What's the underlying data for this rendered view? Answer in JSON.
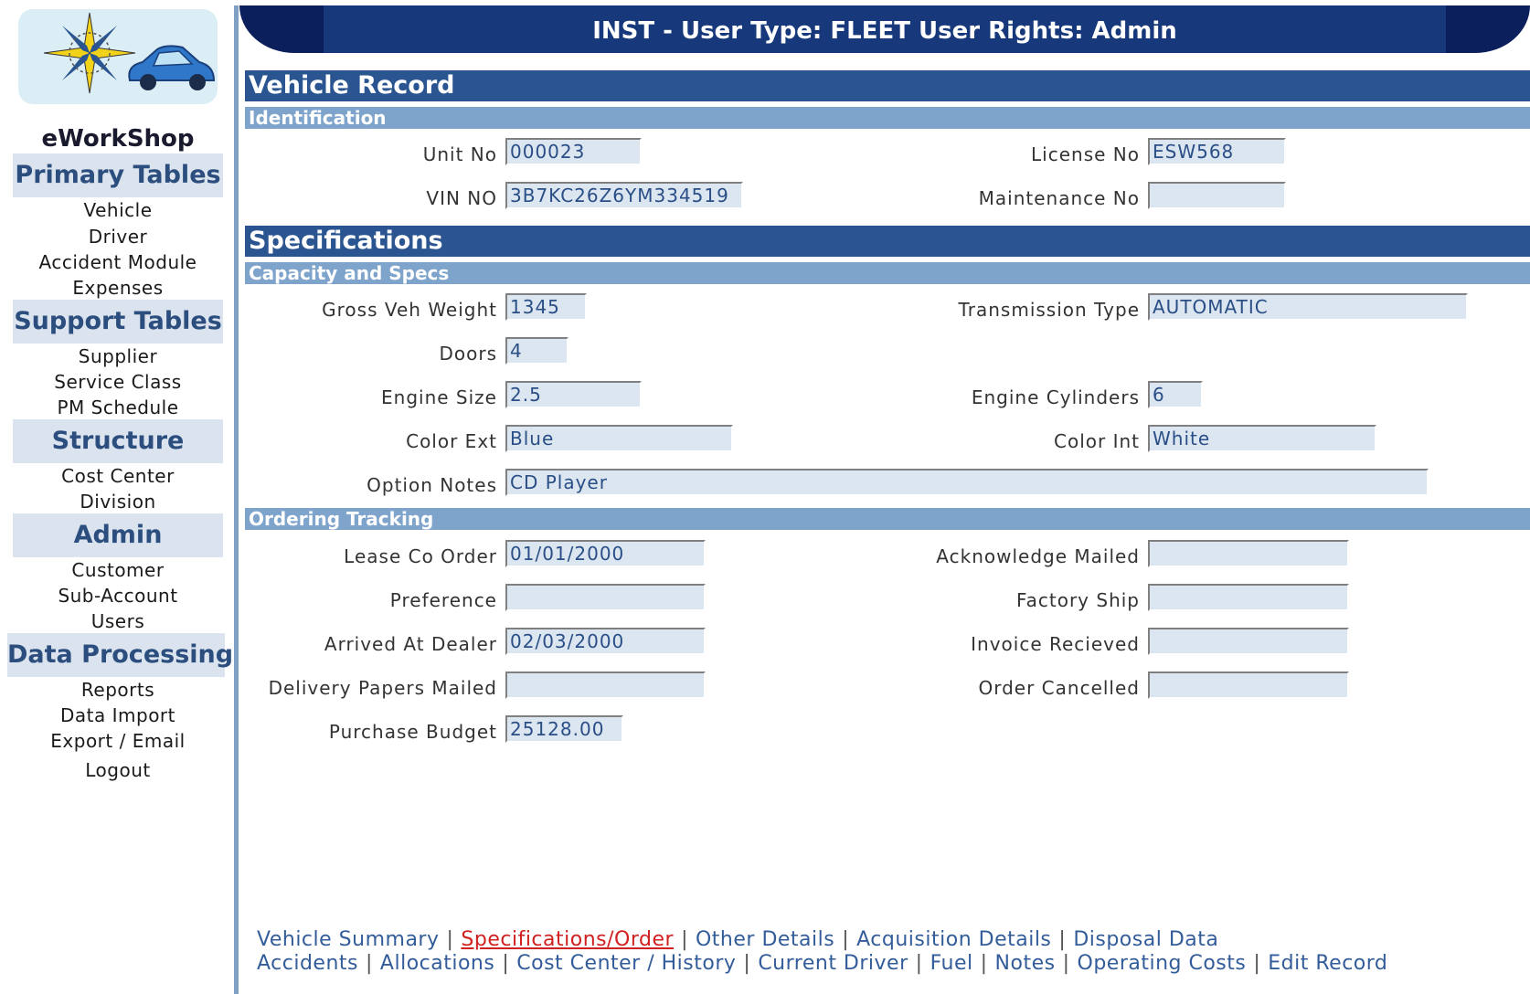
{
  "header": {
    "title": "INST - User Type: FLEET User Rights: Admin"
  },
  "sidebar": {
    "app_name": "eWorkShop",
    "sections": [
      {
        "title": "Primary Tables",
        "items": [
          "Vehicle",
          "Driver",
          "Accident Module",
          "Expenses"
        ]
      },
      {
        "title": "Support Tables",
        "items": [
          "Supplier",
          "Service Class",
          "PM Schedule"
        ]
      },
      {
        "title": "Structure",
        "items": [
          "Cost Center",
          "Division"
        ]
      },
      {
        "title": "Admin",
        "items": [
          "Customer",
          "Sub-Account",
          "Users"
        ]
      },
      {
        "title": "Data Processing",
        "items": [
          "Reports",
          "Data Import",
          "Export / Email",
          "Logout"
        ]
      }
    ]
  },
  "main": {
    "record_title": "Vehicle Record",
    "identification": {
      "title": "Identification",
      "unit_no": {
        "label": "Unit No",
        "value": "000023"
      },
      "license_no": {
        "label": "License No",
        "value": "ESW568"
      },
      "vin_no": {
        "label": "VIN NO",
        "value": "3B7KC26Z6YM334519"
      },
      "maintenance_no": {
        "label": "Maintenance No",
        "value": ""
      }
    },
    "specifications_title": "Specifications",
    "capacity": {
      "title": "Capacity and Specs",
      "gross_veh_weight": {
        "label": "Gross Veh Weight",
        "value": "1345"
      },
      "transmission_type": {
        "label": "Transmission Type",
        "value": "AUTOMATIC"
      },
      "doors": {
        "label": "Doors",
        "value": "4"
      },
      "engine_size": {
        "label": "Engine Size",
        "value": "2.5"
      },
      "engine_cylinders": {
        "label": "Engine Cylinders",
        "value": "6"
      },
      "color_ext": {
        "label": "Color Ext",
        "value": "Blue"
      },
      "color_int": {
        "label": "Color Int",
        "value": "White"
      },
      "option_notes": {
        "label": "Option Notes",
        "value": "CD Player"
      }
    },
    "ordering": {
      "title": "Ordering Tracking",
      "lease_co_order": {
        "label": "Lease Co Order",
        "value": "01/01/2000"
      },
      "acknowledge_mailed": {
        "label": "Acknowledge Mailed",
        "value": ""
      },
      "preference": {
        "label": "Preference",
        "value": ""
      },
      "factory_ship": {
        "label": "Factory Ship",
        "value": ""
      },
      "arrived_at_dealer": {
        "label": "Arrived At Dealer",
        "value": "02/03/2000"
      },
      "invoice_recieved": {
        "label": "Invoice Recieved",
        "value": ""
      },
      "delivery_papers_mailed": {
        "label": "Delivery Papers Mailed",
        "value": ""
      },
      "order_cancelled": {
        "label": "Order Cancelled",
        "value": ""
      },
      "purchase_budget": {
        "label": "Purchase Budget",
        "value": "25128.00"
      }
    }
  },
  "footer": {
    "row1": [
      "Vehicle Summary",
      "Specifications/Order",
      "Other Details",
      "Acquisition Details",
      "Disposal Data"
    ],
    "row2": [
      "Accidents",
      "Allocations",
      "Cost Center / History",
      "Current Driver",
      "Fuel",
      "Notes",
      "Operating Costs",
      "Edit Record"
    ],
    "active": "Specifications/Order",
    "active_color": "#d02020",
    "link_color": "#335d9a"
  },
  "colors": {
    "banner": "#0b1f5c",
    "section_bar": "#2b5590",
    "subsection_bar": "#7fa4cc",
    "field_bg": "#dbe6f1",
    "sidebar_head_bg": "#dbe4ee"
  }
}
